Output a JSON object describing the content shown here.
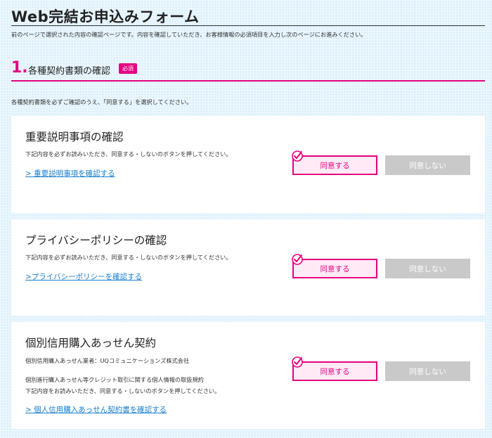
{
  "page": {
    "title": "Web完結お申込みフォーム",
    "intro": "前のページで選択された内容の確認ページです。内容を確認していただき、お客様情報の必須項目を入力し次のページにお進みください。"
  },
  "section": {
    "number": "1.",
    "title": "各種契約書類の確認",
    "badge": "必須",
    "description": "各種契約書類を必ずご確認のうえ、「同意する」を選択してください。"
  },
  "cards": [
    {
      "title": "重要説明事項の確認",
      "lines": [
        "下記内容を必ずお読みいただき、同意する・しないのボタンを押してください。"
      ],
      "link": "> 重要説明事項を確認する",
      "agree_label": "同意する",
      "disagree_label": "同意しない"
    },
    {
      "title": "プライバシーポリシーの確認",
      "lines": [
        "下記内容を必ずお読みいただき、同意する・しないのボタンを押してください。"
      ],
      "link": ">プライバシーポリシーを確認する",
      "agree_label": "同意する",
      "disagree_label": "同意しない"
    },
    {
      "title": "個別信用購入あっせん契約",
      "lines": [
        "個別信用購入あっせん業者：UQコミュニケーションズ株式会社",
        "個別進行購入あっせん等クレジット取引に関する個人情報の取扱規約",
        "下記内容をお読みいただき、同意する・しないのボタンを押してください。"
      ],
      "link": "> 個人信用購入あっせん契約書を確認する",
      "agree_label": "同意する",
      "disagree_label": "同意しない"
    }
  ],
  "colors": {
    "accent": "#e4007f",
    "link": "#1a7fce",
    "disabled": "#c9c9c9"
  },
  "icons": {
    "agree_check": "check-circle-icon"
  }
}
